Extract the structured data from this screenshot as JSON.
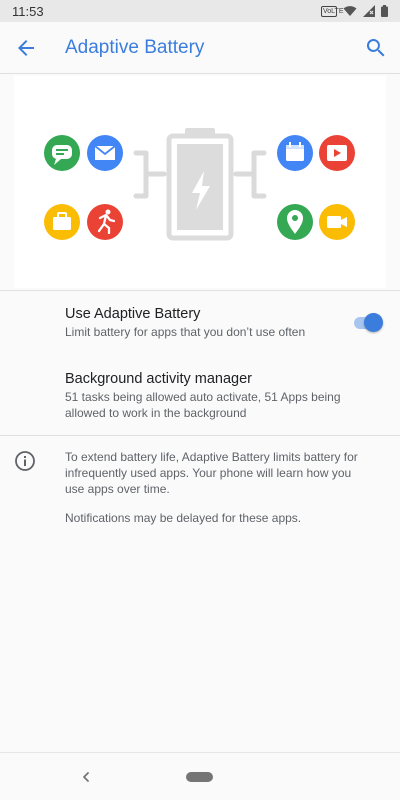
{
  "status_bar": {
    "time": "11:53",
    "volte_label": "VoLTE",
    "icons": [
      "volte-icon",
      "wifi-icon",
      "signal-icon",
      "battery-icon"
    ]
  },
  "app_bar": {
    "title": "Adaptive Battery",
    "back_icon": "arrow-back-icon",
    "search_icon": "search-icon"
  },
  "illustration": {
    "left_icons": [
      "messages-icon",
      "email-icon",
      "briefcase-icon",
      "fitness-icon"
    ],
    "right_icons": [
      "calendar-icon",
      "video-icon",
      "maps-icon",
      "camera-icon"
    ],
    "center_icon": "battery-charging-icon"
  },
  "settings": {
    "adaptive_battery": {
      "title": "Use Adaptive Battery",
      "summary": "Limit battery for apps that you don’t use often",
      "enabled": true
    },
    "background_manager": {
      "title": "Background activity manager",
      "summary_line1": "51 tasks being allowed auto activate, 51 Apps being",
      "summary_line2": "allowed to work in the background"
    }
  },
  "footer": {
    "info_icon": "info-icon",
    "line1": "To extend battery life, Adaptive Battery limits battery for",
    "line2": "infrequently used apps. Your phone will learn how you",
    "line3": "use apps over time.",
    "note": "Notifications may be delayed for these apps."
  },
  "nav_bar": {
    "back_icon": "nav-back-icon",
    "home_icon": "home-pill-icon"
  },
  "colors": {
    "accent": "#3b7ddd",
    "green": "#34a853",
    "blue": "#4285f4",
    "yellow": "#fbbc04",
    "red": "#ea4335"
  }
}
